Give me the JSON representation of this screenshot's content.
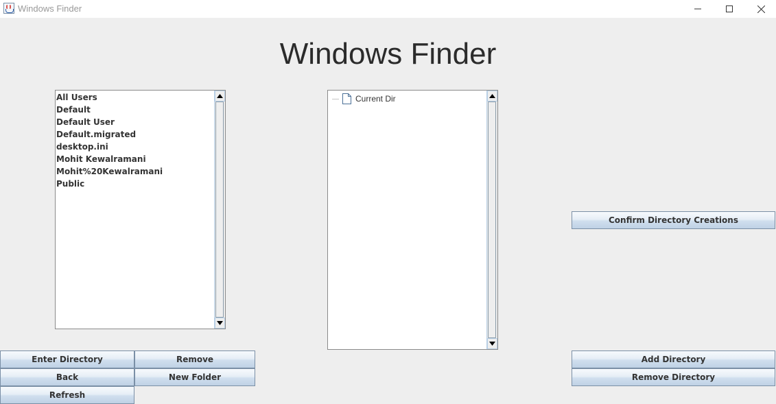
{
  "window": {
    "title": "Windows Finder",
    "controls": [
      "minimize",
      "maximize",
      "close"
    ]
  },
  "heading": "Windows Finder",
  "directory_list": {
    "items": [
      "All Users",
      "Default",
      "Default User",
      "Default.migrated",
      "desktop.ini",
      "Mohit Kewalramani",
      "Mohit%20Kewalramani",
      "Public"
    ]
  },
  "tree": {
    "root_label": "Current Dir",
    "root_icon": "file-icon"
  },
  "buttons": {
    "enter_directory": "Enter Directory",
    "remove": "Remove",
    "back": "Back",
    "new_folder": "New Folder",
    "refresh": "Refresh",
    "confirm_directory_creations": "Confirm Directory Creations",
    "add_directory": "Add Directory",
    "remove_directory": "Remove Directory"
  },
  "colors": {
    "background": "#eeeeee",
    "button_border": "#7a8fa6",
    "scrollbar_border": "#b8cfe5"
  }
}
